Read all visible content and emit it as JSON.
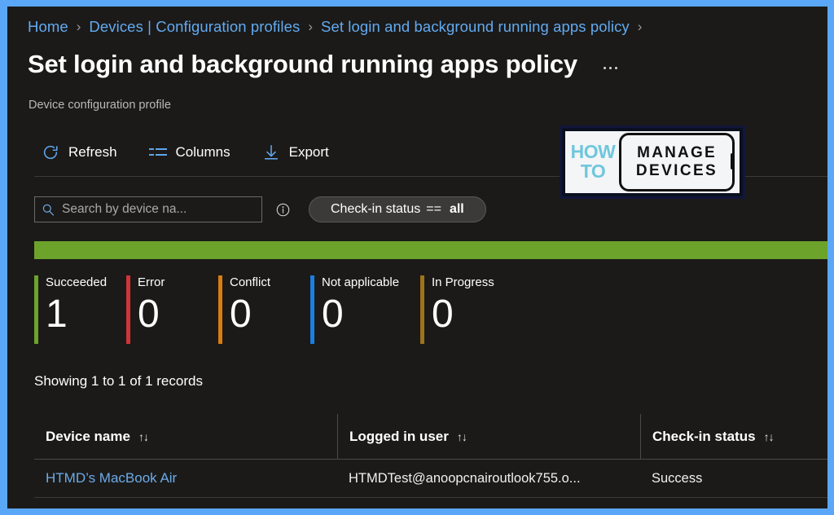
{
  "theme": {
    "frame_color": "#5BA7F7",
    "page_bg": "#1b1a19",
    "link_color": "#62aaf0",
    "accent_green": "#6ba32b"
  },
  "breadcrumb": {
    "separator": "›",
    "items": [
      {
        "label": "Home"
      },
      {
        "label": "Devices | Configuration profiles"
      },
      {
        "label": "Set login and background running apps policy"
      }
    ],
    "trailing_separator": "›"
  },
  "header": {
    "title": "Set login and background running apps policy",
    "subtitle": "Device configuration profile",
    "more_button": "More commands"
  },
  "toolbar": {
    "items": [
      {
        "label": "Refresh",
        "icon": "refresh-icon"
      },
      {
        "label": "Columns",
        "icon": "columns-icon"
      },
      {
        "label": "Export",
        "icon": "export-icon"
      }
    ]
  },
  "logo": {
    "line_how": "HOW",
    "line_to": "TO",
    "line_manage": "MANAGE",
    "line_devices": "DEVICES",
    "alt": "How to Manage Devices"
  },
  "filters": {
    "search": {
      "value": "",
      "placeholder": "Search by device na...",
      "icon": "search-icon"
    },
    "info_icon": "info-icon",
    "pill": {
      "field": "Check-in status",
      "operator": "==",
      "value": "all"
    }
  },
  "summary": {
    "bar_color": "#6ba32b",
    "bar_fill_percent": 100,
    "tiles": [
      {
        "label": "Succeeded",
        "value": "1",
        "color": "#6ba32b"
      },
      {
        "label": "Error",
        "value": "0",
        "color": "#d13438"
      },
      {
        "label": "Conflict",
        "value": "0",
        "color": "#d97c12"
      },
      {
        "label": "Not applicable",
        "value": "0",
        "color": "#1a7fe0"
      },
      {
        "label": "In Progress",
        "value": "0",
        "color": "#9d741c"
      }
    ]
  },
  "records_text": "Showing 1 to 1 of 1 records",
  "table": {
    "sort_icon": "↑↓",
    "columns": [
      {
        "label": "Device name"
      },
      {
        "label": "Logged in user"
      },
      {
        "label": "Check-in status"
      }
    ],
    "rows": [
      {
        "device_name": "HTMD’s MacBook Air",
        "logged_in_user": "HTMDTest@anoopcnairoutlook755.o...",
        "check_in_status": "Success"
      }
    ]
  }
}
